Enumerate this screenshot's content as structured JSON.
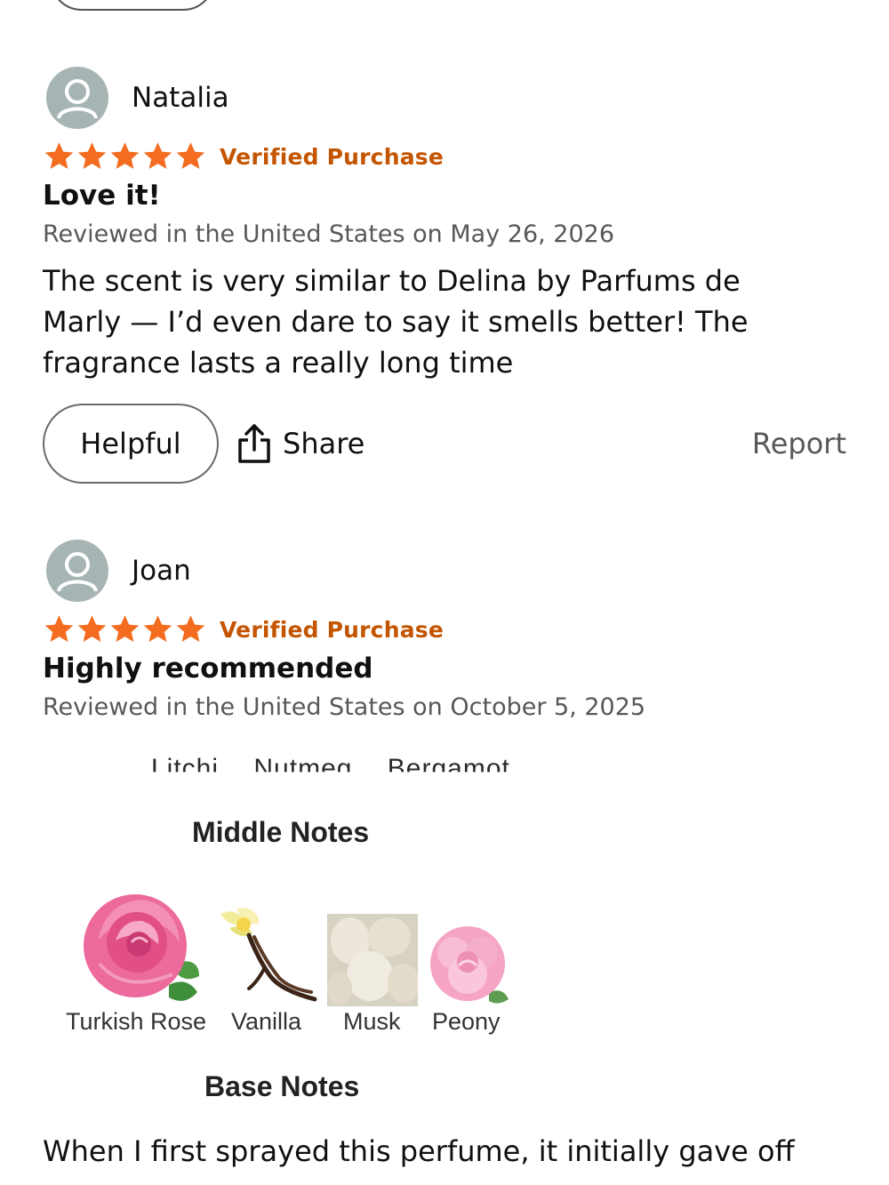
{
  "reviews": [
    {
      "reviewer": "Natalia",
      "rating": 5,
      "verified": "Verified Purchase",
      "title": "Love it!",
      "date": "Reviewed in the United States on May 26, 2026",
      "body": "The scent is very similar to Delina by Parfums de Marly — I’d even dare to say it smells better! The fragrance lasts a really long time",
      "actions": {
        "helpful": "Helpful",
        "share": "Share",
        "report": "Report"
      }
    },
    {
      "reviewer": "Joan",
      "rating": 5,
      "verified": "Verified Purchase",
      "title": "Highly recommended",
      "date": "Reviewed in the United States on October 5, 2025",
      "image": {
        "top_notes_partial": [
          "Litchi",
          "Nutmeg",
          "Bergamot"
        ],
        "middle_heading": "Middle Notes",
        "middle_notes": [
          "Turkish Rose",
          "Vanilla",
          "Musk",
          "Peony"
        ],
        "base_heading": "Base Notes"
      },
      "body_start": "When I first sprayed this perfume, it initially gave off"
    }
  ],
  "colors": {
    "star": "#f36c1f",
    "verified": "#c45500",
    "avatar": "#a7b4b4",
    "secondary_text": "#565959"
  },
  "icons": {
    "avatar": "user-silhouette-icon",
    "star": "star-icon",
    "share": "share-upload-icon"
  }
}
